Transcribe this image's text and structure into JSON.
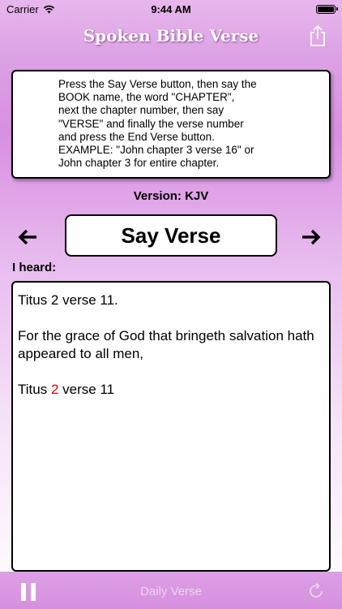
{
  "status_bar": {
    "carrier": "Carrier",
    "time": "9:44 AM"
  },
  "nav": {
    "title": "Spoken Bible Verse",
    "share_icon": "share-icon"
  },
  "instructions": {
    "lines": [
      "Press the Say Verse button, then say the",
      "BOOK name, the word \"CHAPTER\",",
      "next the chapter number, then say",
      "\"VERSE\" and finally the verse number",
      "and press the End Verse button.",
      "EXAMPLE: \"John chapter 3 verse 16\" or",
      "John chapter 3 for entire chapter."
    ]
  },
  "version": "Version: KJV",
  "controls": {
    "prev_icon": "arrow-left-icon",
    "next_icon": "arrow-right-icon",
    "say_button_label": "Say Verse"
  },
  "heard": {
    "label": "I heard:",
    "recognized": "Titus 2 verse 11.",
    "verse_text": "For the grace of God that bringeth salvation hath appeared to all men,",
    "reference_book": "Titus",
    "reference_chapter": "2",
    "reference_rest": "verse 11",
    "highlight_color": "#e00000"
  },
  "bottom_bar": {
    "pause_icon": "pause-icon",
    "daily_verse_label": "Daily Verse",
    "refresh_icon": "refresh-icon"
  }
}
